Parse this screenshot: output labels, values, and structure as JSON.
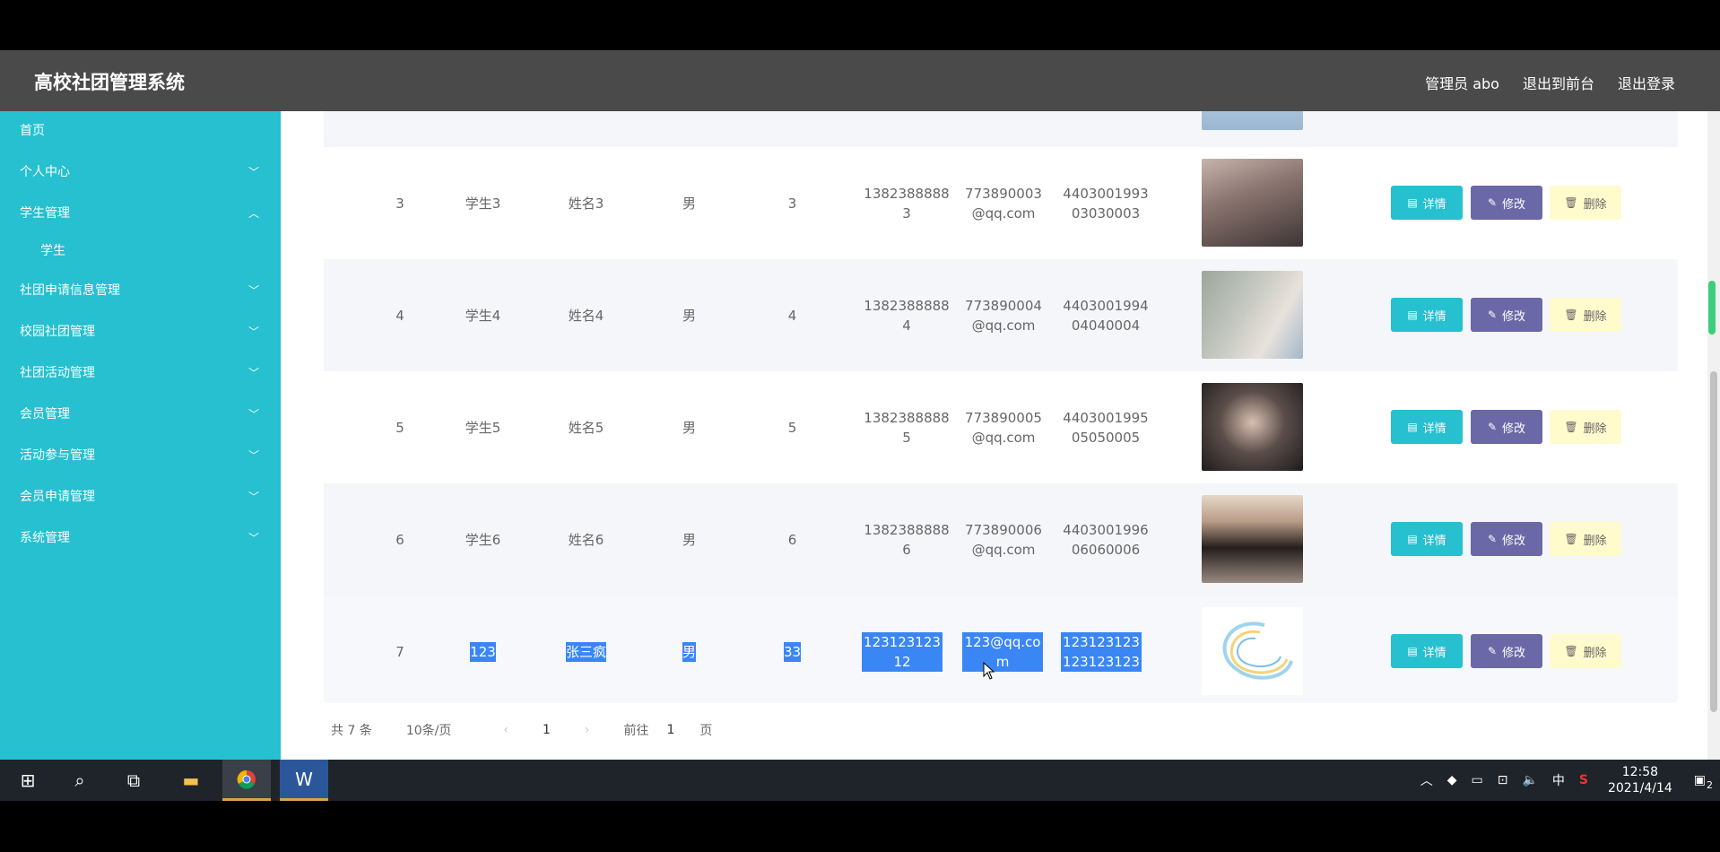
{
  "app": {
    "title": "高校社团管理系统",
    "user_label": "管理员 abo",
    "front_link": "退出到前台",
    "logout_link": "退出登录"
  },
  "sidebar": {
    "items": [
      {
        "label": "首页",
        "chevron": ""
      },
      {
        "label": "个人中心",
        "chevron": "﹀"
      },
      {
        "label": "学生管理",
        "chevron": "︿"
      },
      {
        "label": "学生",
        "chevron": ""
      },
      {
        "label": "社团申请信息管理",
        "chevron": "﹀"
      },
      {
        "label": "校园社团管理",
        "chevron": "﹀"
      },
      {
        "label": "社团活动管理",
        "chevron": "﹀"
      },
      {
        "label": "会员管理",
        "chevron": "﹀"
      },
      {
        "label": "活动参与管理",
        "chevron": "﹀"
      },
      {
        "label": "会员申请管理",
        "chevron": "﹀"
      },
      {
        "label": "系统管理",
        "chevron": "﹀"
      }
    ]
  },
  "table": {
    "rows": [
      {
        "index": "3",
        "account": "学生3",
        "name": "姓名3",
        "gender": "男",
        "age": "3",
        "phone": "13823888883",
        "email": "773890003@qq.com",
        "idcard": "440300199303030003"
      },
      {
        "index": "4",
        "account": "学生4",
        "name": "姓名4",
        "gender": "男",
        "age": "4",
        "phone": "13823888884",
        "email": "773890004@qq.com",
        "idcard": "440300199404040004"
      },
      {
        "index": "5",
        "account": "学生5",
        "name": "姓名5",
        "gender": "男",
        "age": "5",
        "phone": "13823888885",
        "email": "773890005@qq.com",
        "idcard": "440300199505050005"
      },
      {
        "index": "6",
        "account": "学生6",
        "name": "姓名6",
        "gender": "男",
        "age": "6",
        "phone": "13823888886",
        "email": "773890006@qq.com",
        "idcard": "440300199606060006"
      },
      {
        "index": "7",
        "account": "123",
        "name": "张三疯",
        "gender": "男",
        "age": "33",
        "phone": "12312312312",
        "email": "123@qq.com",
        "idcard": "123123123123123123"
      }
    ],
    "buttons": {
      "detail": "详情",
      "edit": "修改",
      "delete": "删除"
    }
  },
  "pager": {
    "total": "共 7 条",
    "page_size": "10条/页",
    "current": "1",
    "goto_label": "前往",
    "goto_value": "1",
    "page_unit": "页"
  },
  "taskbar": {
    "time": "12:58",
    "date": "2021/4/14",
    "ime": "中",
    "notifications": "2"
  }
}
